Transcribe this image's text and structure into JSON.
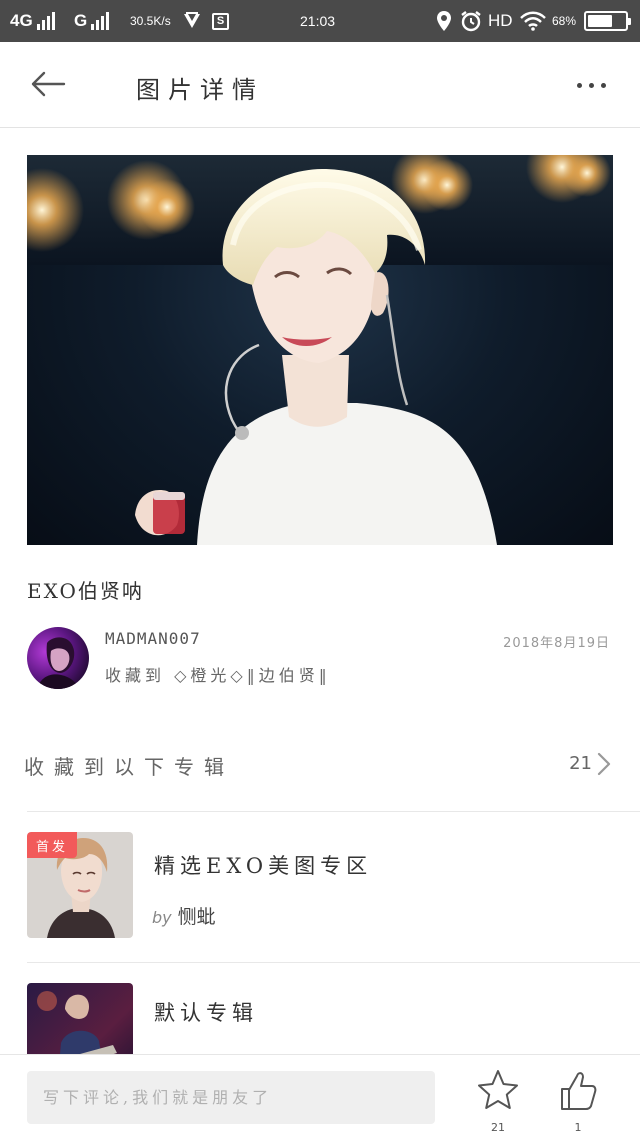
{
  "status_bar": {
    "network_1": "4G",
    "network_2": "G",
    "speed": "30.5K/s",
    "s_icon_letter": "S",
    "time": "21:03",
    "hd": "HD",
    "battery_pct": "68%",
    "battery_level": 0.68
  },
  "header": {
    "title": "图片详情"
  },
  "image": {
    "title": "EXO伯贤呐"
  },
  "author": {
    "name": "MADMAN007",
    "date": "2018年8月19日",
    "collected_to": "收藏到 ◇橙光◇‖边伯贤‖"
  },
  "albums_section": {
    "title": "收藏到以下专辑",
    "count": "21"
  },
  "albums": [
    {
      "title": "精选EXO美图专区",
      "badge": "首发",
      "by_word": "by",
      "by_name": "恻蚍"
    },
    {
      "title": "默认专辑"
    }
  ],
  "bottom_bar": {
    "comment_placeholder": "写下评论,我们就是朋友了",
    "favorite_count": "21",
    "like_count": "1"
  },
  "colors": {
    "status_bar_bg": "#4a4a4a",
    "badge_red": "#f25a5a",
    "input_bg": "#efefef"
  },
  "icons": [
    "back-arrow-icon",
    "more-dots-icon",
    "chevron-right-icon",
    "star-icon",
    "thumbs-up-icon",
    "signal-icon",
    "location-icon",
    "alarm-icon",
    "wifi-icon",
    "battery-icon"
  ]
}
